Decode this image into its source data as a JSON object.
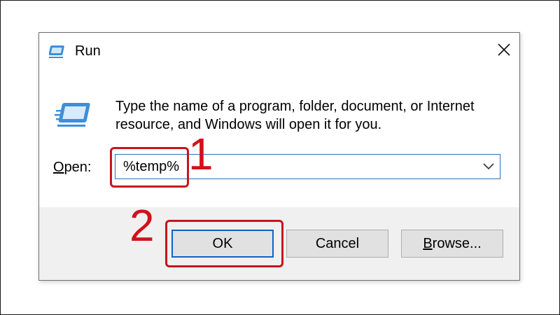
{
  "dialog": {
    "title": "Run",
    "description": "Type the name of a program, folder, document, or Internet resource, and Windows will open it for you.",
    "open_label_accel": "O",
    "open_label_rest": "pen:",
    "open_value": "%temp%",
    "buttons": {
      "ok": "OK",
      "cancel": "Cancel",
      "browse_accel": "B",
      "browse_rest": "rowse..."
    }
  },
  "annotations": {
    "step1": "1",
    "step2": "2",
    "color": "#d1121b"
  },
  "icons": {
    "title": "run-icon",
    "body": "run-icon",
    "close": "close-icon",
    "dropdown": "chevron-down-icon"
  }
}
